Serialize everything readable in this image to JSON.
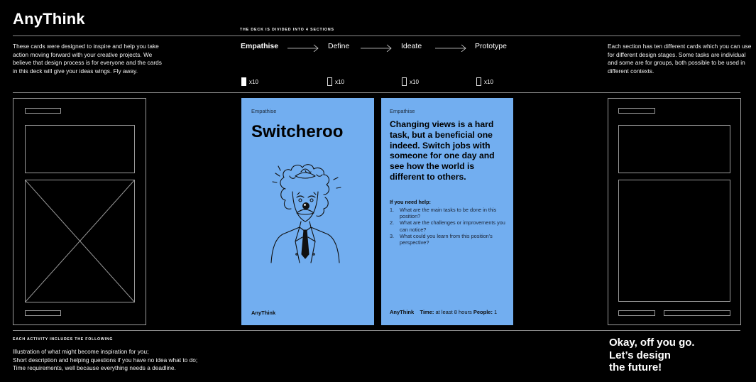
{
  "header": {
    "brand": "AnyThink",
    "deck_caption": "THE DECK IS DIVIDED INTO 4 SECTIONS"
  },
  "intro_text": "These cards were designed to inspire and help you take action moving forward with your creative projects. We believe that design process is for everyone and the cards in this deck will give your ideas wings. Fly away.",
  "stages": [
    {
      "label": "Empathise",
      "count": "x10",
      "active": true
    },
    {
      "label": "Define",
      "count": "x10",
      "active": false
    },
    {
      "label": "Ideate",
      "count": "x10",
      "active": false
    },
    {
      "label": "Prototype",
      "count": "x10",
      "active": false
    }
  ],
  "side_text": "Each section has ten different cards which you can use for different design stages. Some tasks are individual and some are for groups, both possible to be used in different contexts.",
  "card_front": {
    "category": "Empathise",
    "title": "Switcheroo",
    "brand": "AnyThink",
    "illustration": "clown-portrait"
  },
  "card_back": {
    "category": "Empathise",
    "description": "Changing views is a hard task, but a beneficial one indeed. Switch jobs with someone for one day and see how the world is different to others.",
    "help_heading": "If you need help:",
    "help_items": [
      {
        "num": "1.",
        "text": "What are the main tasks to be done in this position?"
      },
      {
        "num": "2.",
        "text": "What are the challenges or improvements you can notice?"
      },
      {
        "num": "3.",
        "text": "What could you learn from this position's perspective?"
      }
    ],
    "brand": "AnyThink",
    "time_label": "Time:",
    "time_value": "at least 8 hours",
    "people_label": "People:",
    "people_value": "1"
  },
  "activity": {
    "heading": "EACH ACTIVITY INCLUDES THE FOLLOWING",
    "items": [
      "Illustration of what might become inspiration for you;",
      "Short description and helping questions if you have no idea what to do;",
      "Time requirements, well because everything needs a deadline."
    ]
  },
  "outro": [
    "Okay, off you go.",
    "Let’s design",
    "the future!"
  ],
  "colors": {
    "background": "#000000",
    "card_blue": "#72aef0",
    "text": "#ffffff",
    "wire": "#9a9a9a"
  }
}
